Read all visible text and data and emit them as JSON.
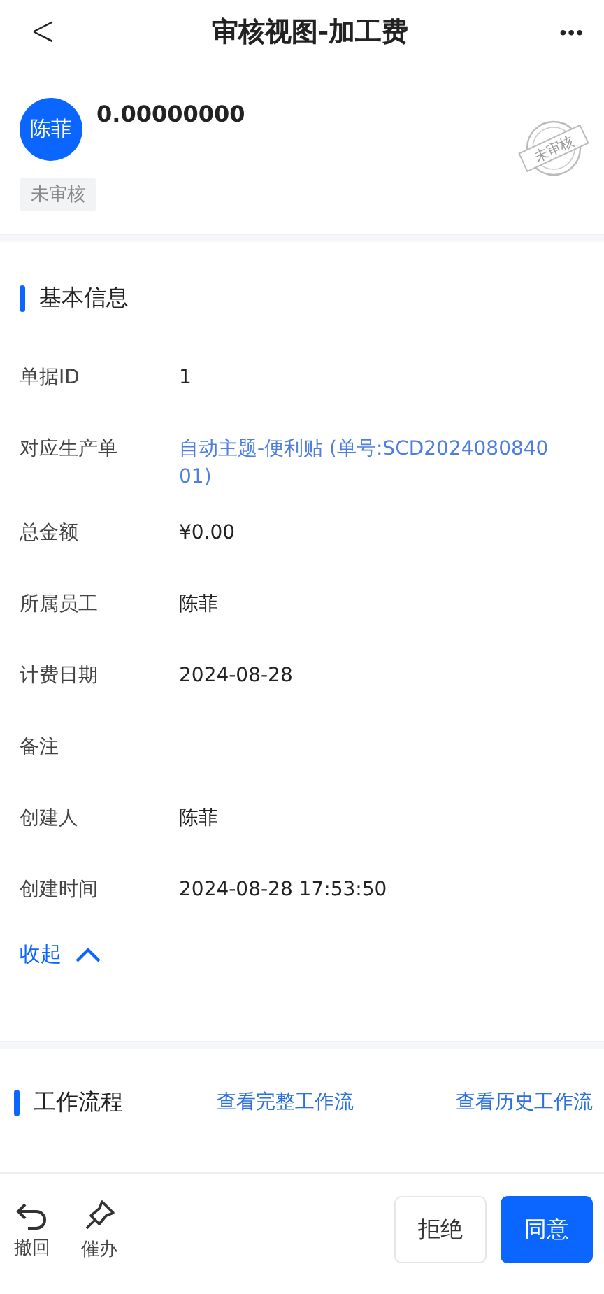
{
  "header": {
    "back": "<",
    "title": "审核视图-加工费",
    "more": "•••"
  },
  "profile": {
    "avatar": "陈菲",
    "amount": "0.00000000",
    "status_tag": "未审核",
    "stamp": "未审核"
  },
  "basic_info": {
    "title": "基本信息",
    "fields": [
      {
        "label": "单据ID",
        "value": "1",
        "kind": "text"
      },
      {
        "label": "对应生产单",
        "value": "自动主题-便利贴 (单号:SCD202408084001)",
        "kind": "link"
      },
      {
        "label": "总金额",
        "value": "¥0.00",
        "kind": "text"
      },
      {
        "label": "所属员工",
        "value": "陈菲",
        "kind": "text"
      },
      {
        "label": "计费日期",
        "value": "2024-08-28",
        "kind": "text"
      },
      {
        "label": "备注",
        "kind": "empty"
      },
      {
        "label": "创建人",
        "value": "陈菲",
        "kind": "text"
      },
      {
        "label": "创建时间",
        "value": "2024-08-28 17:53:50",
        "kind": "text"
      }
    ],
    "collapse": "收起",
    "expanded": true
  },
  "workflow": {
    "title": "工作流程",
    "links": [
      "查看完整工作流",
      "查看历史工作流"
    ]
  },
  "bottom_bar": {
    "actions": [
      {
        "label": "撤回",
        "kind": "undo"
      },
      {
        "label": "催办",
        "kind": "pin"
      }
    ],
    "reject": "拒绝",
    "approve": "同意"
  }
}
